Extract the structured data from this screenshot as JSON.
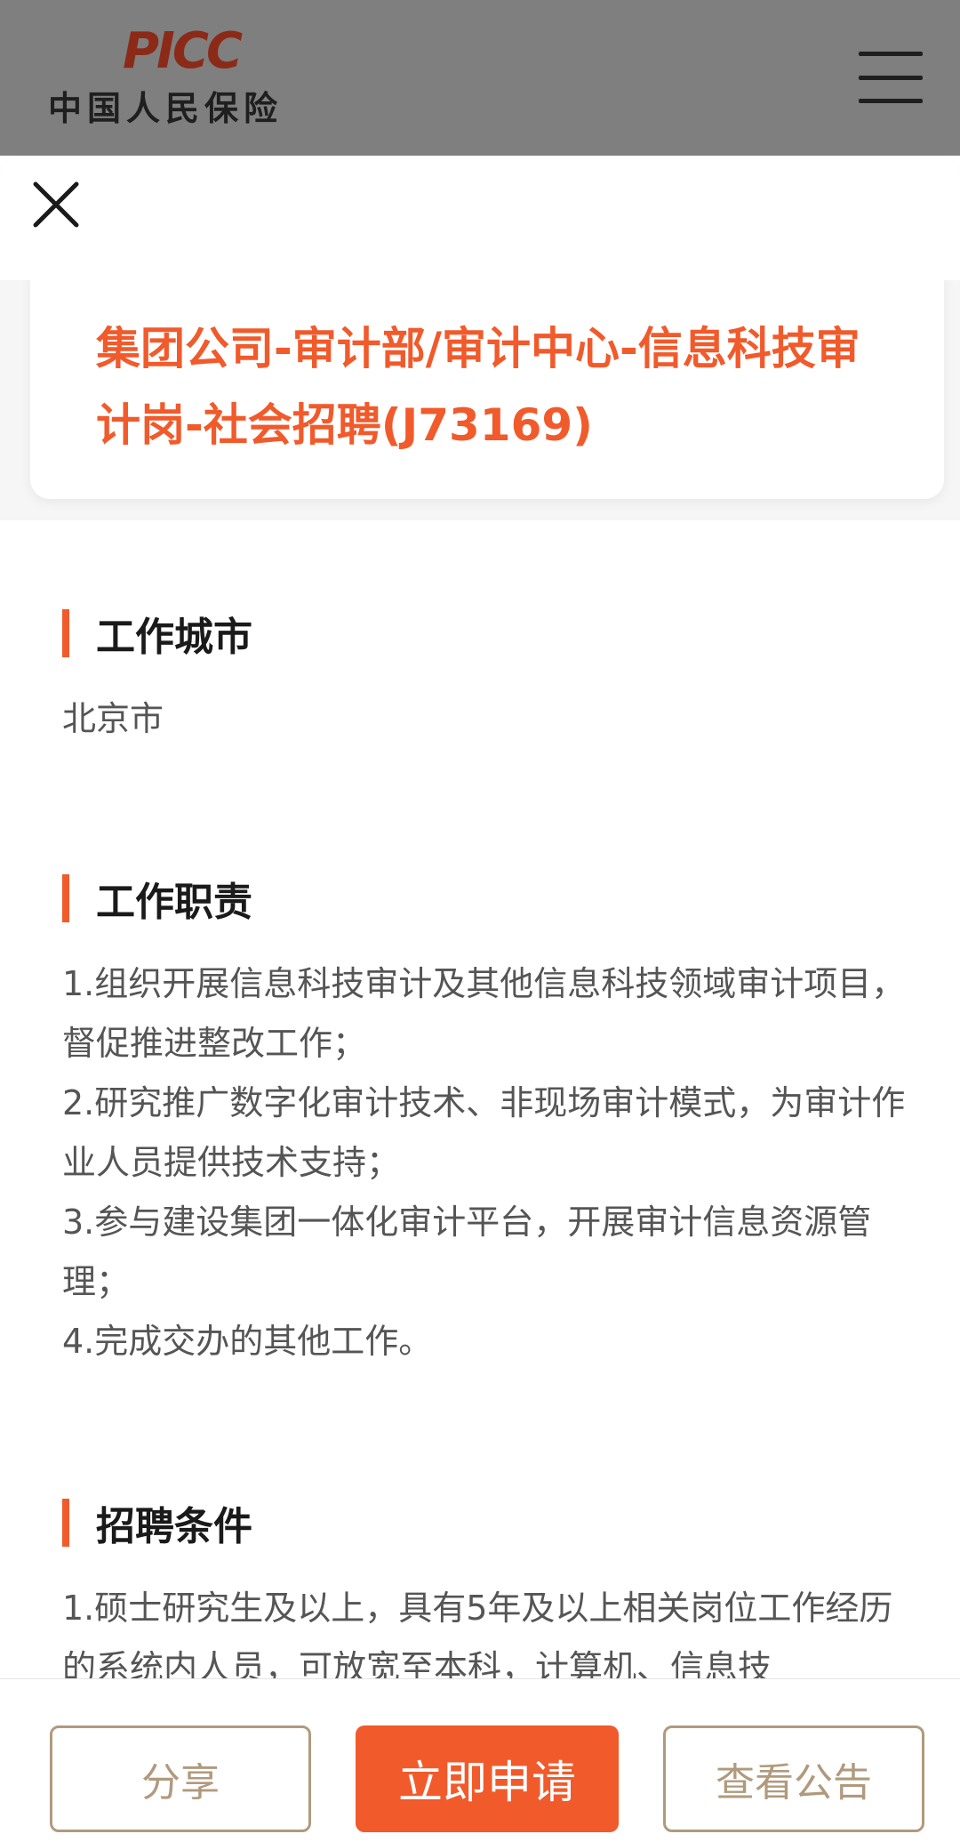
{
  "header": {
    "logo_mark": "PICC",
    "logo_text": "中国人民保险",
    "menu_icon": "hamburger-menu-icon"
  },
  "modal": {
    "close_icon": "close-icon",
    "job_title": "集团公司-审计部/审计中心-信息科技审计岗-社会招聘(J73169)",
    "sections": [
      {
        "title": "工作城市",
        "lines": [
          "北京市"
        ]
      },
      {
        "title": "工作职责",
        "lines": [
          "1.组织开展信息科技审计及其他信息科技领域审计项目，督促推进整改工作；",
          "2.研究推广数字化审计技术、非现场审计模式，为审计作业人员提供技术支持；",
          "3.参与建设集团一体化审计平台，开展审计信息资源管理；",
          "4.完成交办的其他工作。"
        ]
      },
      {
        "title": "招聘条件",
        "lines": [
          "1.硕士研究生及以上，具有5年及以上相关岗位工作经历的系统内人员，可放宽至本科，计算机、信息技"
        ]
      }
    ]
  },
  "actions": {
    "share_label": "分享",
    "apply_label": "立即申请",
    "notice_label": "查看公告"
  },
  "colors": {
    "accent": "#f15a2b",
    "outline_button": "#b09a7d",
    "header_dim": "#7f7f7f"
  }
}
